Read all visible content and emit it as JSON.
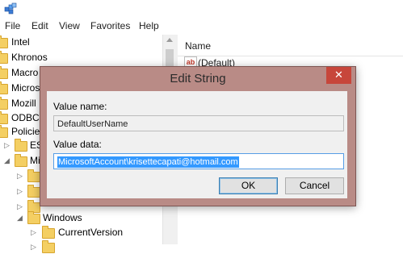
{
  "menu": [
    "File",
    "Edit",
    "View",
    "Favorites",
    "Help"
  ],
  "tree": {
    "items": [
      "Intel",
      "Khronos",
      "Macro",
      "Micros",
      "Mozill",
      "ODBC",
      "Policie",
      "ESI",
      "Mi",
      "Windows",
      "CurrentVersion"
    ]
  },
  "values_pane": {
    "column_name": "Name",
    "default_value": "(Default)"
  },
  "dialog": {
    "title": "Edit String",
    "close_glyph": "✕",
    "value_name_label": "Value name:",
    "value_name": "DefaultUserName",
    "value_data_label": "Value data:",
    "value_data": "MicrosoftAccount\\krisettecapati@hotmail.com",
    "ok_label": "OK",
    "cancel_label": "Cancel"
  },
  "colors": {
    "dialog_frame": "#b98b86",
    "close_button": "#c7463b",
    "selection": "#3399ff",
    "folder": "#f4cf63"
  },
  "icons": [
    "regedit-app-icon",
    "folder-icon",
    "string-value-icon",
    "close-icon",
    "expand-arrow-icon",
    "collapse-arrow-icon"
  ]
}
